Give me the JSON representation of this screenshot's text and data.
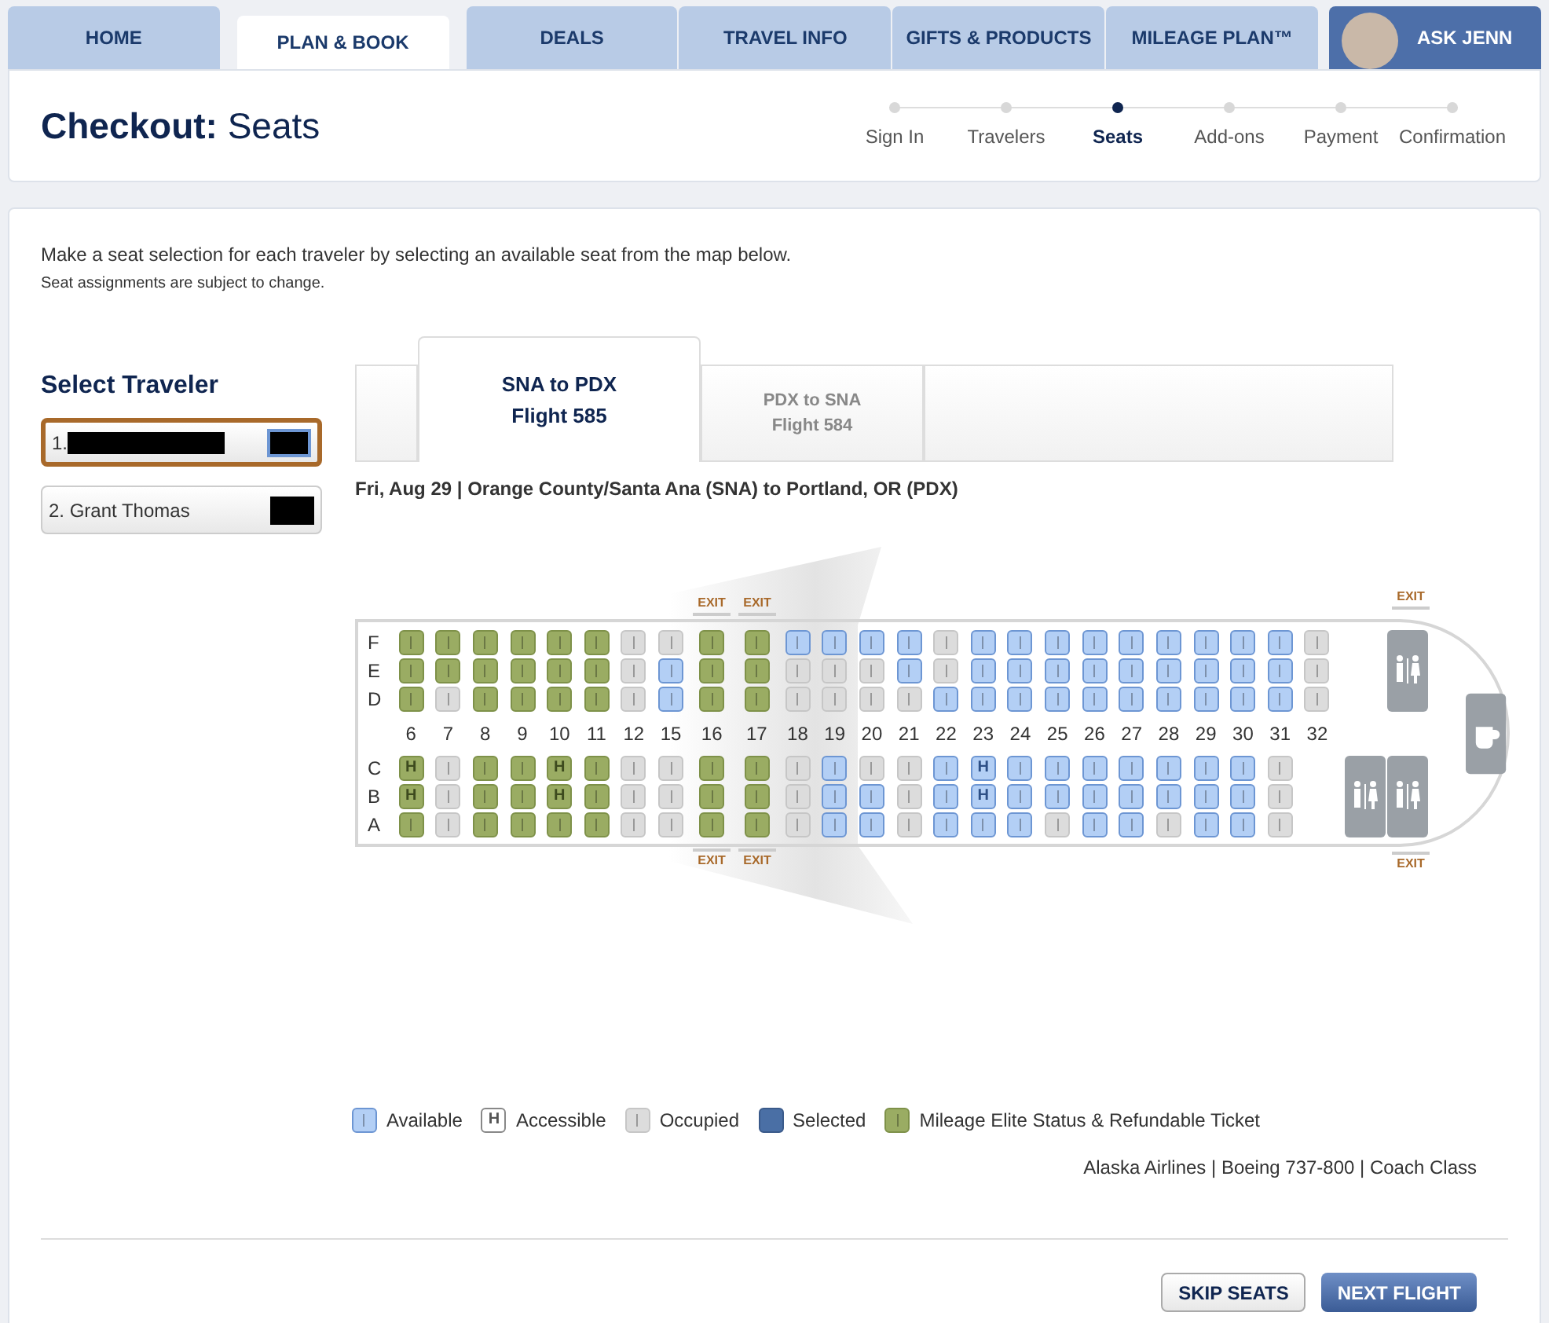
{
  "nav": {
    "tabs": [
      {
        "label": "HOME",
        "selected": false
      },
      {
        "label": "PLAN & BOOK",
        "selected": true
      },
      {
        "label": "DEALS",
        "selected": false
      },
      {
        "label": "TRAVEL INFO",
        "selected": false
      },
      {
        "label": "GIFTS & PRODUCTS",
        "selected": false
      },
      {
        "label": "MILEAGE PLAN™",
        "selected": false
      }
    ],
    "assistant": "ASK JENN"
  },
  "header": {
    "title_bold": "Checkout:",
    "title": "Seats",
    "steps": [
      {
        "label": "Sign In",
        "selected": false
      },
      {
        "label": "Travelers",
        "selected": false
      },
      {
        "label": "Seats",
        "selected": true
      },
      {
        "label": "Add-ons",
        "selected": false
      },
      {
        "label": "Payment",
        "selected": false
      },
      {
        "label": "Confirmation",
        "selected": false
      }
    ]
  },
  "intro": "Make a seat selection for each traveler by selecting an available seat from the map below.",
  "note": "Seat assignments are subject to change.",
  "travelers": {
    "title": "Select Traveler",
    "items": [
      {
        "label": "1.",
        "name_redacted": true,
        "selected": true
      },
      {
        "label": "2. Grant Thomas",
        "name_redacted": false,
        "selected": false
      }
    ]
  },
  "flight_tabs": [
    {
      "route": "SNA to PDX",
      "flight": "Flight 585",
      "selected": true
    },
    {
      "route": "PDX to SNA",
      "flight": "Flight 584",
      "selected": false
    }
  ],
  "route_line": "Fri, Aug 29 | Orange County/Santa Ana (SNA) to Portland, OR (PDX)",
  "seatmap": {
    "upper_letters": [
      "F",
      "E",
      "D"
    ],
    "lower_letters": [
      "C",
      "B",
      "A"
    ],
    "exits": [
      {
        "label": "EXIT"
      },
      {
        "label": "EXIT"
      },
      {
        "label": "EXIT"
      },
      {
        "label": "EXIT"
      },
      {
        "label": "EXIT"
      },
      {
        "label": "EXIT"
      }
    ],
    "rows": [
      {
        "label": "6",
        "exit": false,
        "seats": [
          {
            "kind": "elite"
          },
          {
            "kind": "elite"
          },
          {
            "kind": "elite"
          },
          {
            "kind": "elite",
            "mark": "H"
          },
          {
            "kind": "elite",
            "mark": "H"
          },
          {
            "kind": "elite"
          }
        ]
      },
      {
        "label": "7",
        "exit": false,
        "seats": [
          {
            "kind": "elite"
          },
          {
            "kind": "elite"
          },
          {
            "kind": "occupied"
          },
          {
            "kind": "occupied"
          },
          {
            "kind": "occupied"
          },
          {
            "kind": "occupied"
          }
        ]
      },
      {
        "label": "8",
        "exit": false,
        "seats": [
          {
            "kind": "elite"
          },
          {
            "kind": "elite"
          },
          {
            "kind": "elite"
          },
          {
            "kind": "elite"
          },
          {
            "kind": "elite"
          },
          {
            "kind": "elite"
          }
        ]
      },
      {
        "label": "9",
        "exit": false,
        "seats": [
          {
            "kind": "elite"
          },
          {
            "kind": "elite"
          },
          {
            "kind": "elite"
          },
          {
            "kind": "elite"
          },
          {
            "kind": "elite"
          },
          {
            "kind": "elite"
          }
        ]
      },
      {
        "label": "10",
        "exit": false,
        "seats": [
          {
            "kind": "elite"
          },
          {
            "kind": "elite"
          },
          {
            "kind": "elite"
          },
          {
            "kind": "elite",
            "mark": "H"
          },
          {
            "kind": "elite",
            "mark": "H"
          },
          {
            "kind": "elite"
          }
        ]
      },
      {
        "label": "11",
        "exit": false,
        "seats": [
          {
            "kind": "elite"
          },
          {
            "kind": "elite"
          },
          {
            "kind": "elite"
          },
          {
            "kind": "elite"
          },
          {
            "kind": "elite"
          },
          {
            "kind": "elite"
          }
        ]
      },
      {
        "label": "12",
        "exit": false,
        "seats": [
          {
            "kind": "occupied"
          },
          {
            "kind": "occupied"
          },
          {
            "kind": "occupied"
          },
          {
            "kind": "occupied"
          },
          {
            "kind": "occupied"
          },
          {
            "kind": "occupied"
          }
        ]
      },
      {
        "label": "15",
        "exit": false,
        "seats": [
          {
            "kind": "occupied"
          },
          {
            "kind": "available"
          },
          {
            "kind": "available"
          },
          {
            "kind": "occupied"
          },
          {
            "kind": "occupied"
          },
          {
            "kind": "occupied"
          }
        ]
      },
      {
        "label": "16",
        "exit": true,
        "seats": [
          {
            "kind": "elite"
          },
          {
            "kind": "elite"
          },
          {
            "kind": "elite"
          },
          {
            "kind": "elite"
          },
          {
            "kind": "elite"
          },
          {
            "kind": "elite"
          }
        ]
      },
      {
        "label": "17",
        "exit": true,
        "seats": [
          {
            "kind": "elite"
          },
          {
            "kind": "elite"
          },
          {
            "kind": "elite"
          },
          {
            "kind": "elite"
          },
          {
            "kind": "elite"
          },
          {
            "kind": "elite"
          }
        ]
      },
      {
        "label": "18",
        "exit": false,
        "seats": [
          {
            "kind": "available"
          },
          {
            "kind": "occupied"
          },
          {
            "kind": "occupied"
          },
          {
            "kind": "occupied"
          },
          {
            "kind": "occupied"
          },
          {
            "kind": "occupied"
          }
        ]
      },
      {
        "label": "19",
        "exit": false,
        "seats": [
          {
            "kind": "available"
          },
          {
            "kind": "occupied"
          },
          {
            "kind": "occupied"
          },
          {
            "kind": "available"
          },
          {
            "kind": "available"
          },
          {
            "kind": "available"
          }
        ]
      },
      {
        "label": "20",
        "exit": false,
        "seats": [
          {
            "kind": "available"
          },
          {
            "kind": "occupied"
          },
          {
            "kind": "occupied"
          },
          {
            "kind": "occupied"
          },
          {
            "kind": "available"
          },
          {
            "kind": "available"
          }
        ]
      },
      {
        "label": "21",
        "exit": false,
        "seats": [
          {
            "kind": "available"
          },
          {
            "kind": "available"
          },
          {
            "kind": "occupied"
          },
          {
            "kind": "occupied"
          },
          {
            "kind": "occupied"
          },
          {
            "kind": "occupied"
          }
        ]
      },
      {
        "label": "22",
        "exit": false,
        "seats": [
          {
            "kind": "occupied"
          },
          {
            "kind": "occupied"
          },
          {
            "kind": "available"
          },
          {
            "kind": "available"
          },
          {
            "kind": "available"
          },
          {
            "kind": "available"
          }
        ]
      },
      {
        "label": "23",
        "exit": false,
        "seats": [
          {
            "kind": "available"
          },
          {
            "kind": "available"
          },
          {
            "kind": "available"
          },
          {
            "kind": "available",
            "mark": "H"
          },
          {
            "kind": "available",
            "mark": "H"
          },
          {
            "kind": "available"
          }
        ]
      },
      {
        "label": "24",
        "exit": false,
        "seats": [
          {
            "kind": "available"
          },
          {
            "kind": "available"
          },
          {
            "kind": "available"
          },
          {
            "kind": "available"
          },
          {
            "kind": "available"
          },
          {
            "kind": "available"
          }
        ]
      },
      {
        "label": "25",
        "exit": false,
        "seats": [
          {
            "kind": "available"
          },
          {
            "kind": "available"
          },
          {
            "kind": "available"
          },
          {
            "kind": "available"
          },
          {
            "kind": "available"
          },
          {
            "kind": "occupied"
          }
        ]
      },
      {
        "label": "26",
        "exit": false,
        "seats": [
          {
            "kind": "available"
          },
          {
            "kind": "available"
          },
          {
            "kind": "available"
          },
          {
            "kind": "available"
          },
          {
            "kind": "available"
          },
          {
            "kind": "available"
          }
        ]
      },
      {
        "label": "27",
        "exit": false,
        "seats": [
          {
            "kind": "available"
          },
          {
            "kind": "available"
          },
          {
            "kind": "available"
          },
          {
            "kind": "available"
          },
          {
            "kind": "available"
          },
          {
            "kind": "available"
          }
        ]
      },
      {
        "label": "28",
        "exit": false,
        "seats": [
          {
            "kind": "available"
          },
          {
            "kind": "available"
          },
          {
            "kind": "available"
          },
          {
            "kind": "available"
          },
          {
            "kind": "available"
          },
          {
            "kind": "occupied"
          }
        ]
      },
      {
        "label": "29",
        "exit": false,
        "seats": [
          {
            "kind": "available"
          },
          {
            "kind": "available"
          },
          {
            "kind": "available"
          },
          {
            "kind": "available"
          },
          {
            "kind": "available"
          },
          {
            "kind": "available"
          }
        ]
      },
      {
        "label": "30",
        "exit": false,
        "seats": [
          {
            "kind": "available"
          },
          {
            "kind": "available"
          },
          {
            "kind": "available"
          },
          {
            "kind": "available"
          },
          {
            "kind": "available"
          },
          {
            "kind": "available"
          }
        ]
      },
      {
        "label": "31",
        "exit": false,
        "seats": [
          {
            "kind": "available"
          },
          {
            "kind": "available"
          },
          {
            "kind": "available"
          },
          {
            "kind": "occupied"
          },
          {
            "kind": "occupied"
          },
          {
            "kind": "occupied"
          }
        ]
      },
      {
        "label": "32",
        "exit": false,
        "seats": [
          {
            "kind": "occupied"
          },
          {
            "kind": "occupied"
          },
          {
            "kind": "occupied"
          }
        ]
      }
    ]
  },
  "legend": [
    {
      "kind": "available",
      "label": "Available"
    },
    {
      "kind": "accessible",
      "label": "Accessible",
      "mark": "H"
    },
    {
      "kind": "occupied",
      "label": "Occupied"
    },
    {
      "kind": "selected",
      "label": "Selected"
    },
    {
      "kind": "elite",
      "label": "Mileage Elite Status & Refundable Ticket"
    }
  ],
  "aircraft": "Alaska Airlines | Boeing 737-800 | Coach Class",
  "buttons": [
    {
      "kind": "secondary",
      "label": "SKIP SEATS"
    },
    {
      "kind": "primary",
      "label": "NEXT FLIGHT"
    }
  ]
}
